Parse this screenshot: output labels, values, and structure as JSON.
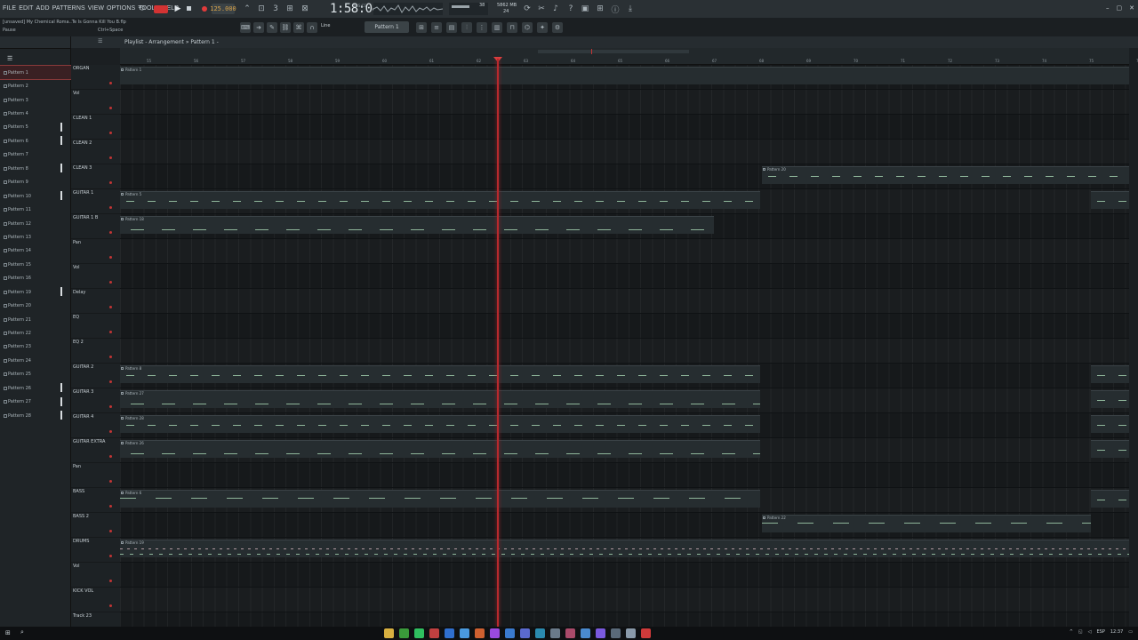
{
  "menu": [
    "FILE",
    "EDIT",
    "ADD",
    "PATTERNS",
    "VIEW",
    "OPTIONS",
    "TOOLS",
    "HELP"
  ],
  "transport": {
    "tempo": "125.000",
    "time": "1:58:04",
    "time_sub": "M:S:CS",
    "cpu": "38",
    "memory": "5862 MB",
    "polyphony": "24"
  },
  "song_title": "[unsaved] My Chemical Roma..Te Is Gonna Kill You B.flp",
  "hint_left": "Pause",
  "hint_shortcut": "Ctrl+Space",
  "snap": "Line",
  "pattern_selector": "Pattern 1",
  "playlist_title": "Playlist - Arrangement » Pattern 1 -",
  "window_controls": [
    "–",
    "▢",
    "✕"
  ],
  "patterns": [
    "Pattern 1",
    "Pattern 2",
    "Pattern 3",
    "Pattern 4",
    "Pattern 5",
    "Pattern 6",
    "Pattern 7",
    "Pattern 8",
    "Pattern 9",
    "Pattern 10",
    "Pattern 11",
    "Pattern 12",
    "Pattern 13",
    "Pattern 14",
    "Pattern 15",
    "Pattern 16",
    "Pattern 19",
    "Pattern 20",
    "Pattern 21",
    "Pattern 22",
    "Pattern 23",
    "Pattern 24",
    "Pattern 25",
    "Pattern 26",
    "Pattern 27",
    "Pattern 28"
  ],
  "bars": [
    "55",
    "56",
    "57",
    "58",
    "59",
    "60",
    "61",
    "62",
    "63",
    "64",
    "65",
    "66",
    "67",
    "68",
    "69",
    "70",
    "71",
    "72",
    "73",
    "74",
    "75",
    "76"
  ],
  "tracks": [
    "ORGAN",
    "Vol",
    "CLEAN 1",
    "CLEAN 2",
    "CLEAN 3",
    "GUITAR 1",
    "GUITAR 1 B",
    "Pan",
    "Vol",
    "Delay",
    "EQ",
    "EQ 2",
    "GUITAR 2",
    "GUITAR 3",
    "GUITAR 4",
    "GUITAR EXTRA",
    "Pan",
    "BASS",
    "BASS 2",
    "DRUMS",
    "Vol",
    "KICK VOL",
    "Track 23"
  ],
  "clips": {
    "organ": "Pattern 1",
    "clean3": "Pattern 20",
    "guitar1": "Pattern 5",
    "guitar1b": "Pattern 18",
    "guitar2": "Pattern 8",
    "guitar3": "Pattern 27",
    "guitar4": "Pattern 28",
    "guitar_extra": "Pattern 26",
    "bass": "Pattern 6",
    "bass2": "Pattern 22",
    "drums": "Pattern 19"
  },
  "tray": {
    "lang": "ESP",
    "clock": "12:37"
  },
  "colors": {
    "accent_red": "#d33333",
    "note_green": "#8fb59a",
    "bg": "#16191b"
  }
}
